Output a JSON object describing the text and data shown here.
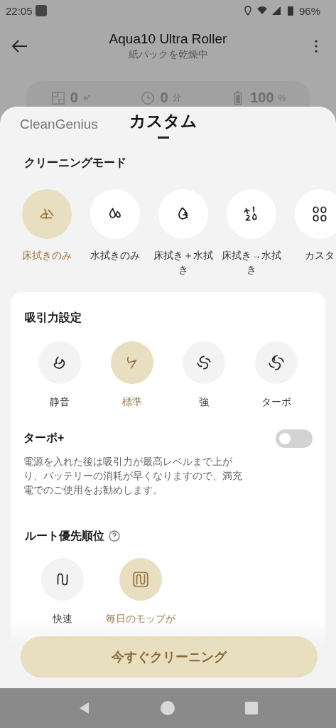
{
  "status_bar": {
    "time": "22:05",
    "battery": "96%"
  },
  "header": {
    "title": "Aqua10 Ultra Roller",
    "subtitle": "紙パックを乾燥中"
  },
  "stats": [
    {
      "kind": "area",
      "value": "0",
      "unit": "㎡"
    },
    {
      "kind": "time",
      "value": "0",
      "unit": "分"
    },
    {
      "kind": "battery",
      "value": "100",
      "unit": "%"
    }
  ],
  "tabs": [
    {
      "label": "CleanGenius",
      "selected": false
    },
    {
      "label": "カスタム",
      "selected": true
    }
  ],
  "cleaning_mode": {
    "title": "クリーニングモード",
    "modes": [
      {
        "kind": "sweep",
        "label": "床拭きのみ",
        "selected": true
      },
      {
        "kind": "mop",
        "label": "水拭きのみ",
        "selected": false
      },
      {
        "kind": "sweep_mop",
        "label": "床拭き＋水拭き",
        "selected": false
      },
      {
        "kind": "sweep_then_mop",
        "label": "床拭き→水拭き",
        "selected": false
      },
      {
        "kind": "custom",
        "label": "カスタ",
        "selected": false
      }
    ]
  },
  "suction": {
    "title": "吸引力設定",
    "levels": [
      {
        "kind": "quiet",
        "label": "静音",
        "selected": false
      },
      {
        "kind": "standard",
        "label": "標準",
        "selected": true
      },
      {
        "kind": "strong",
        "label": "強",
        "selected": false
      },
      {
        "kind": "turbo",
        "label": "ターボ",
        "selected": false
      }
    ]
  },
  "turbo_plus": {
    "label": "ターボ+",
    "on": false,
    "description": "電源を入れた後は吸引力が最高レベルまで上がり、バッテリーの消耗が早くなりますので、満充電でのご使用をお勧めします。"
  },
  "route": {
    "title": "ルート優先順位",
    "options": [
      {
        "kind": "quick",
        "label": "快速",
        "selected": false
      },
      {
        "kind": "mop",
        "label": "毎日のモップが",
        "selected": true
      }
    ]
  },
  "start_button": {
    "label": "今すぐクリーニング"
  }
}
